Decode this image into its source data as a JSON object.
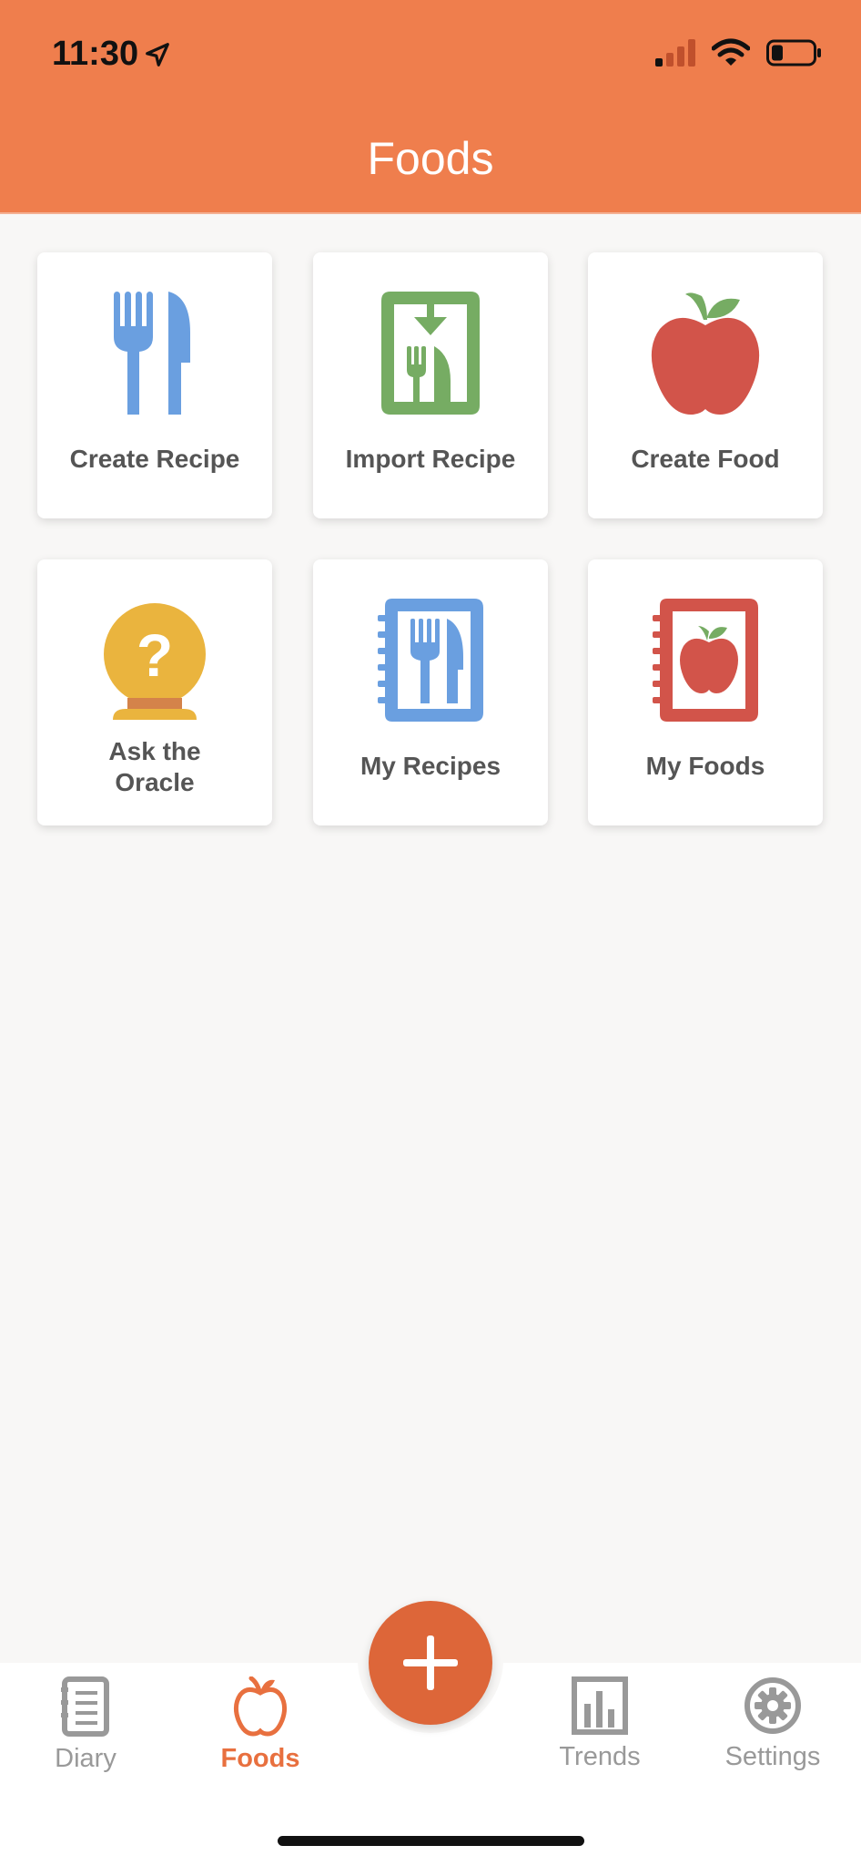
{
  "status": {
    "time": "11:30"
  },
  "header": {
    "title": "Foods"
  },
  "tiles": [
    {
      "label": "Create Recipe",
      "icon": "fork-knife-icon"
    },
    {
      "label": "Import Recipe",
      "icon": "import-recipe-icon"
    },
    {
      "label": "Create Food",
      "icon": "apple-icon"
    },
    {
      "label": "Ask the Oracle",
      "icon": "oracle-ball-icon"
    },
    {
      "label": "My Recipes",
      "icon": "recipe-book-icon"
    },
    {
      "label": "My Foods",
      "icon": "food-book-icon"
    }
  ],
  "tabbar": {
    "tabs": [
      {
        "label": "Diary",
        "icon": "diary-icon",
        "active": false
      },
      {
        "label": "Foods",
        "icon": "apple-outline-icon",
        "active": true
      },
      {
        "label": "Trends",
        "icon": "bar-chart-icon",
        "active": false
      },
      {
        "label": "Settings",
        "icon": "gear-icon",
        "active": false
      }
    ],
    "add_icon": "plus-icon"
  },
  "colors": {
    "header": "#ef7e4d",
    "accent": "#dd6639",
    "blue": "#6a9fe0",
    "green": "#76ac63",
    "red": "#d2544a",
    "gold": "#eab43e"
  }
}
